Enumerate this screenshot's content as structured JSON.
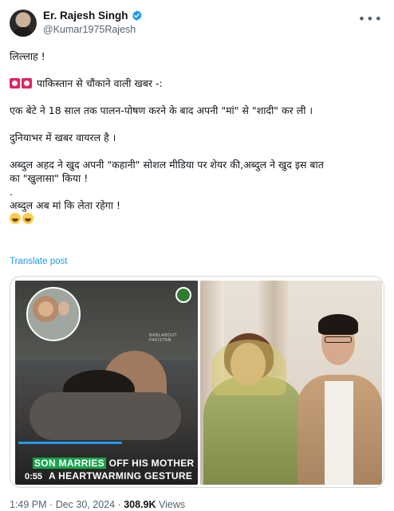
{
  "author": {
    "display_name": "Er. Rajesh Singh",
    "handle": "@Kumar1975Rajesh",
    "verified": true,
    "verified_color": "#1d9bf0"
  },
  "post": {
    "lines": [
      "लिल्लाह !",
      "पाकिस्तान से चौंकाने वाली खबर -:",
      "एक बेटे ने 18 साल तक पालन-पोषण करने के बाद अपनी \"मां\" से \"शादी\" कर ली ।",
      "दुनियाभर में खबर वायरल है ।",
      "अब्दुल अहद ने खुद अपनी \"कहानी\" सोशल मीडिया पर शेयर की,अब्दुल ने खुद इस बात",
      "का \"खुलासा\" किया !",
      ".",
      "अब्दुल अब मां कि लेता रहेगा !"
    ],
    "translate_label": "Translate post"
  },
  "media": {
    "video_caption_highlight": "SON MARRIES",
    "video_caption_rest": " OFF HIS MOTHER",
    "video_caption_line2": "A HEARTWARMING GESTURE",
    "video_duration": "0:55",
    "video_watermark": "BABLABOUT PAKISTAN"
  },
  "meta": {
    "time": "1:49 PM",
    "separator": "·",
    "date": "Dec 30, 2024",
    "views_count": "308.9K",
    "views_label": "Views"
  },
  "colors": {
    "text_primary": "#0f1419",
    "text_secondary": "#536471",
    "link": "#1d9bf0",
    "border": "#cfd9de"
  },
  "icons": {
    "siren": "police-car-light-emoji",
    "laugh": "face-with-tears-of-joy-emoji",
    "more": "more-horizontal-icon"
  }
}
